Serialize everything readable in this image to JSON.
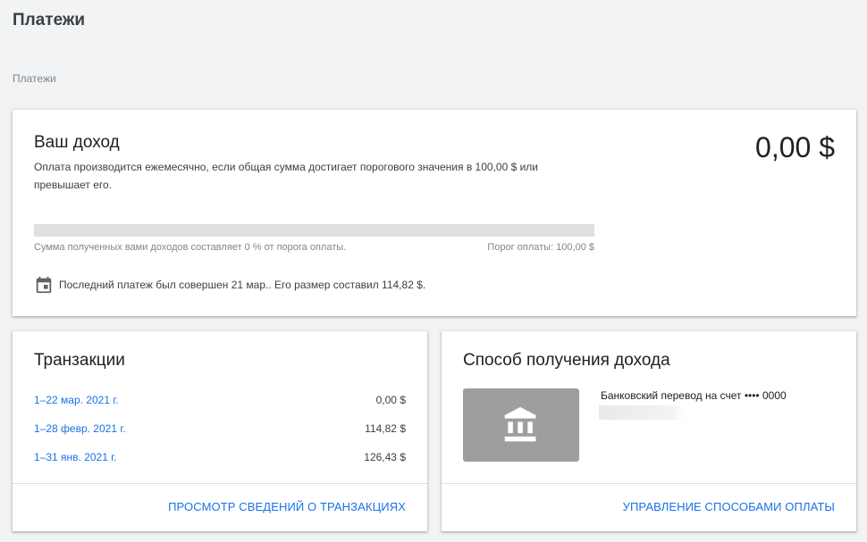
{
  "page": {
    "title": "Платежи",
    "breadcrumb": "Платежи"
  },
  "income": {
    "title": "Ваш доход",
    "description": "Оплата производится ежемесячно, если общая сумма достигает порогового значения в 100,00 $ или превышает его.",
    "amount": "0,00 $",
    "progress_percent": 0,
    "progress_text": "Сумма полученных вами доходов составляет 0 % от порога оплаты.",
    "threshold_text": "Порог оплаты: 100,00 $",
    "last_payment_icon": "calendar-icon",
    "last_payment_text": "Последний платеж был совершен 21 мар.. Его размер составил 114,82 $."
  },
  "transactions": {
    "title": "Транзакции",
    "rows": [
      {
        "date": "1–22 мар. 2021 г.",
        "amount": "0,00 $"
      },
      {
        "date": "1–28 февр. 2021 г.",
        "amount": "114,82 $"
      },
      {
        "date": "1–31 янв. 2021 г.",
        "amount": "126,43 $"
      }
    ],
    "link_label": "ПРОСМОТР СВЕДЕНИЙ О ТРАНЗАКЦИЯХ"
  },
  "payment_method": {
    "title": "Способ получения дохода",
    "bank_icon": "bank-icon",
    "bank_label": "Банковский перевод на счет •••• 0000",
    "link_label": "УПРАВЛЕНИЕ СПОСОБАМИ ОПЛАТЫ"
  },
  "colors": {
    "link": "#1a73e8",
    "background": "#f1f3f4",
    "progress_track": "#e0e0e0",
    "bank_tile": "#9e9e9e"
  }
}
